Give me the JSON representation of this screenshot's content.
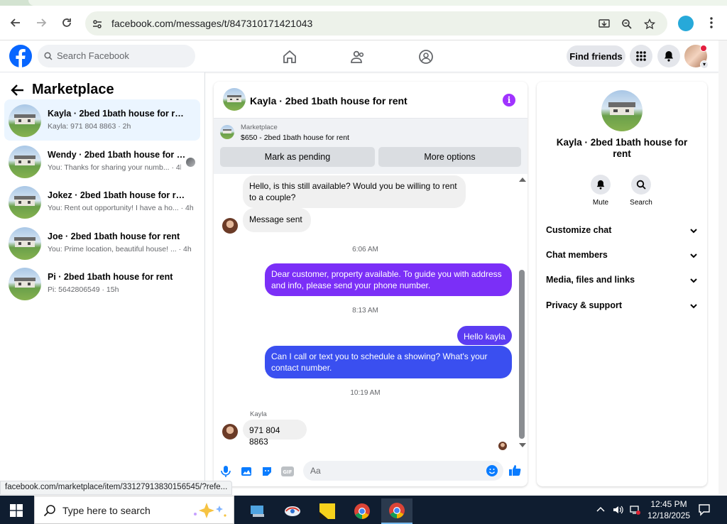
{
  "browser": {
    "url": "facebook.com/messages/t/847310171421043"
  },
  "header": {
    "search_placeholder": "Search Facebook",
    "find_friends": "Find friends"
  },
  "left": {
    "title": "Marketplace",
    "conversations": [
      {
        "name": "Kayla · 2bed 1bath house for rent",
        "snippet": "Kayla: 971 804 8863 · 2h",
        "active": true
      },
      {
        "name": "Wendy · 2bed 1bath house for r...",
        "snippet": "You: Thanks for sharing your numb... · 4h"
      },
      {
        "name": "Jokez · 2bed 1bath house for rent",
        "snippet": "You: Rent out opportunity! I have a ho... · 4h"
      },
      {
        "name": "Joe · 2bed 1bath house for rent",
        "snippet": "You: Prime location, beautiful house! ... · 4h"
      },
      {
        "name": "Pi · 2bed 1bath house for rent",
        "snippet": "Pi: 5642806549 · 15h"
      }
    ]
  },
  "chat": {
    "title": "Kayla · 2bed 1bath house for rent",
    "marketplace_label": "Marketplace",
    "listing": "$650 - 2bed 1bath house for rent",
    "mark_pending": "Mark as pending",
    "more_options": "More options",
    "messages": {
      "m1": "Hello, is this still available? Would you be willing to rent to a couple?",
      "m2": "Message sent",
      "t1": "6:06 AM",
      "m3": "Dear customer, property available. To guide you with address and info, please send your phone number.",
      "t2": "8:13 AM",
      "m4": "Hello kayla",
      "m5": "Can I call or text you to schedule a showing? What's your contact number.",
      "t3": "10:19 AM",
      "sender": "Kayla",
      "m6": "971 804 8863"
    },
    "composer_placeholder": "Aa",
    "colors": {
      "out_top": "#7b2ff7",
      "out_mid": "#5b3cf2",
      "out_bottom": "#3a4ff0"
    }
  },
  "right": {
    "name": "Kayla · 2bed 1bath house for rent",
    "mute": "Mute",
    "search": "Search",
    "sections": [
      "Customize chat",
      "Chat members",
      "Media, files and links",
      "Privacy & support"
    ]
  },
  "status_url": "facebook.com/marketplace/item/33127913830156545/?refe...",
  "taskbar": {
    "search_placeholder": "Type here to search",
    "time": "12:45 PM",
    "date": "12/18/2025"
  }
}
